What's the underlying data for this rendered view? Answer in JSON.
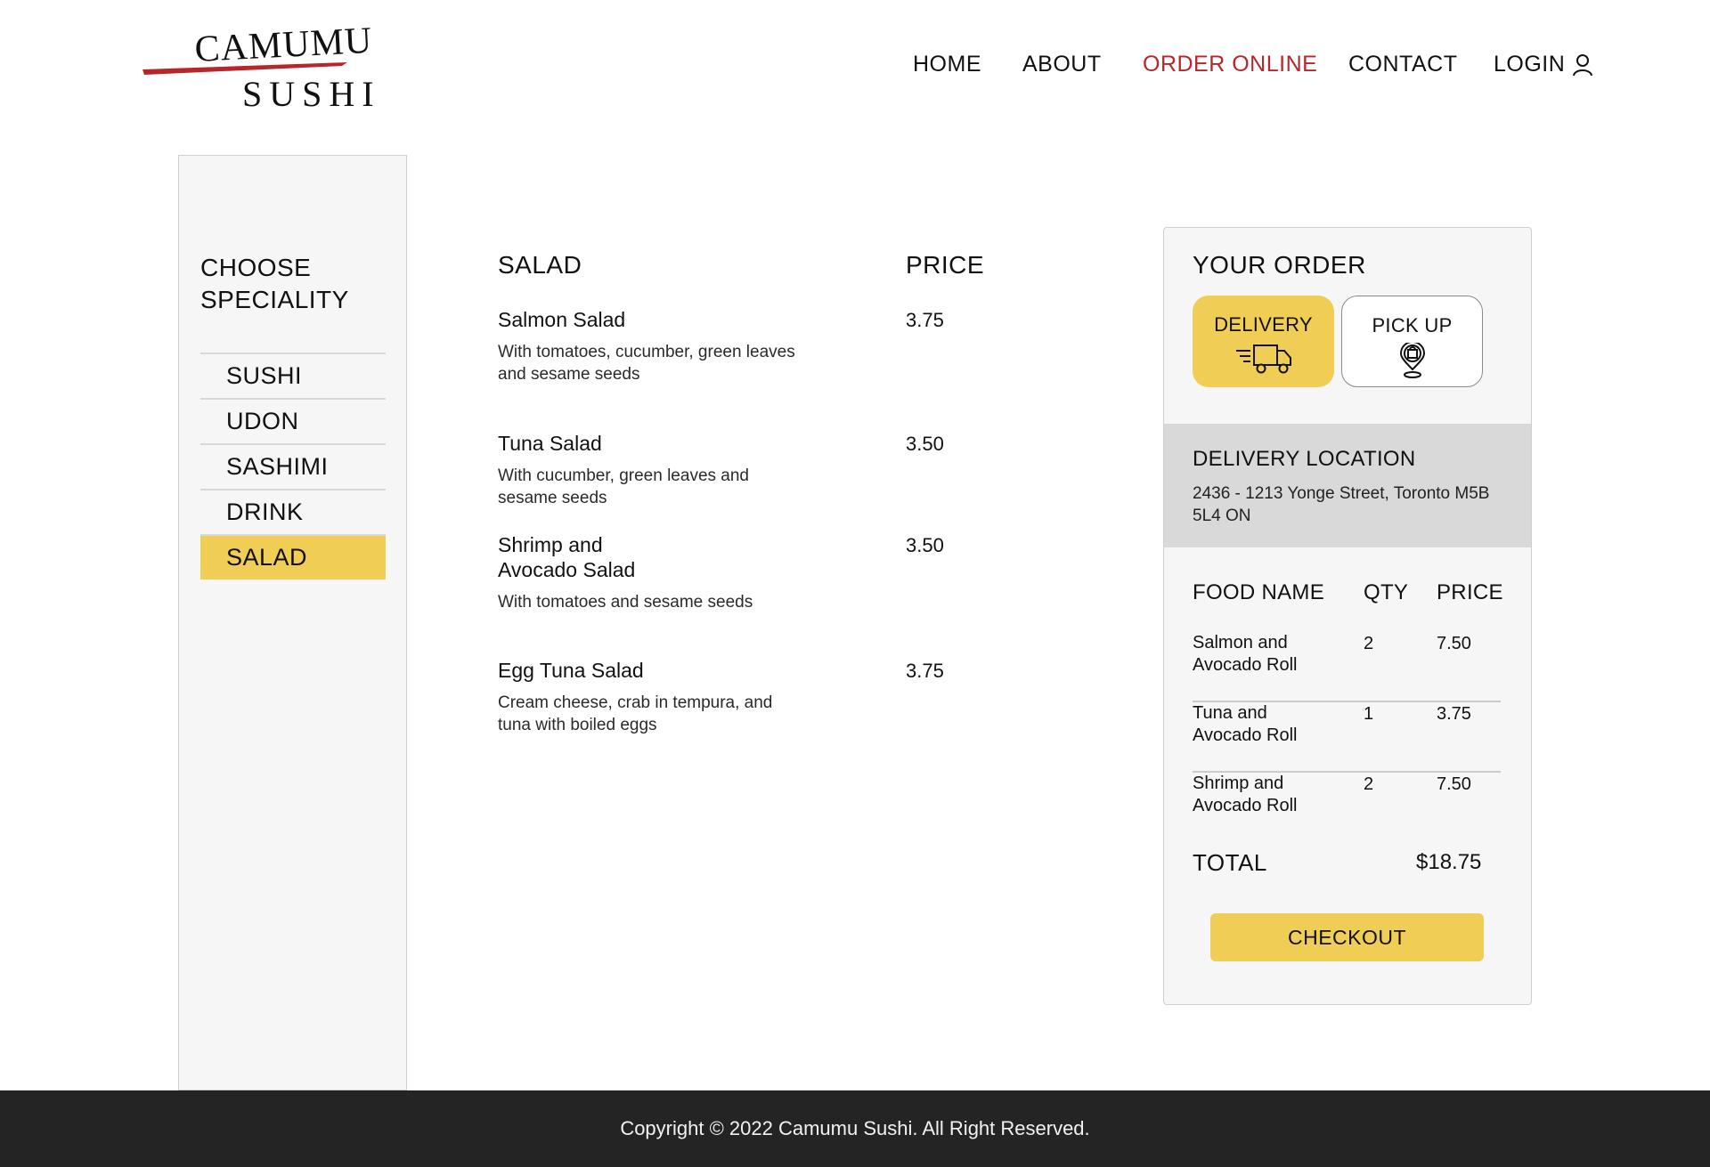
{
  "brand": {
    "logo_top": "CAMUMU",
    "logo_bottom": "SUSHI",
    "accent_color": "#b8262a",
    "highlight_color": "#f0ce55"
  },
  "nav": {
    "items": [
      {
        "label": "HOME"
      },
      {
        "label": "ABOUT"
      },
      {
        "label": "ORDER ONLINE",
        "active": true
      },
      {
        "label": "CONTACT"
      },
      {
        "label": "LOGIN",
        "icon": "user-icon"
      }
    ]
  },
  "sidebar": {
    "title": "CHOOSE SPECIALITY",
    "categories": [
      {
        "label": "SUSHI"
      },
      {
        "label": "UDON"
      },
      {
        "label": "SASHIMI"
      },
      {
        "label": "DRINK"
      },
      {
        "label": "SALAD",
        "selected": true
      }
    ]
  },
  "menu": {
    "section_title": "SALAD",
    "price_header": "PRICE",
    "items": [
      {
        "name": "Salmon Salad",
        "description": "With tomatoes, cucumber, green leaves and sesame seeds",
        "price": "3.75"
      },
      {
        "name": "Tuna Salad",
        "description": "With cucumber, green leaves and sesame seeds",
        "price": "3.50"
      },
      {
        "name": "Shrimp and\nAvocado Salad",
        "description": "With tomatoes and sesame seeds",
        "price": "3.50"
      },
      {
        "name": "Egg Tuna Salad",
        "description": "Cream cheese, crab in tempura, and tuna with boiled eggs",
        "price": "3.75"
      }
    ]
  },
  "order": {
    "title": "YOUR ORDER",
    "modes": [
      {
        "label": "DELIVERY",
        "icon": "delivery-truck-icon",
        "selected": true
      },
      {
        "label": "PICK UP",
        "icon": "pickup-location-icon",
        "selected": false
      }
    ],
    "location": {
      "title": "DELIVERY LOCATION",
      "address": "2436 - 1213 Yonge Street, Toronto M5B 5L4 ON"
    },
    "columns": [
      "FOOD NAME",
      "QTY",
      "PRICE"
    ],
    "lines": [
      {
        "name": "Salmon and Avocado Roll",
        "qty": "2",
        "price": "7.50"
      },
      {
        "name": "Tuna and Avocado Roll",
        "qty": "1",
        "price": "3.75"
      },
      {
        "name": "Shrimp and Avocado Roll",
        "qty": "2",
        "price": "7.50"
      }
    ],
    "total_label": "TOTAL",
    "total_value": "$18.75",
    "checkout_label": "CHECKOUT"
  },
  "footer": {
    "text": "Copyright © 2022 Camumu Sushi. All Right Reserved."
  }
}
